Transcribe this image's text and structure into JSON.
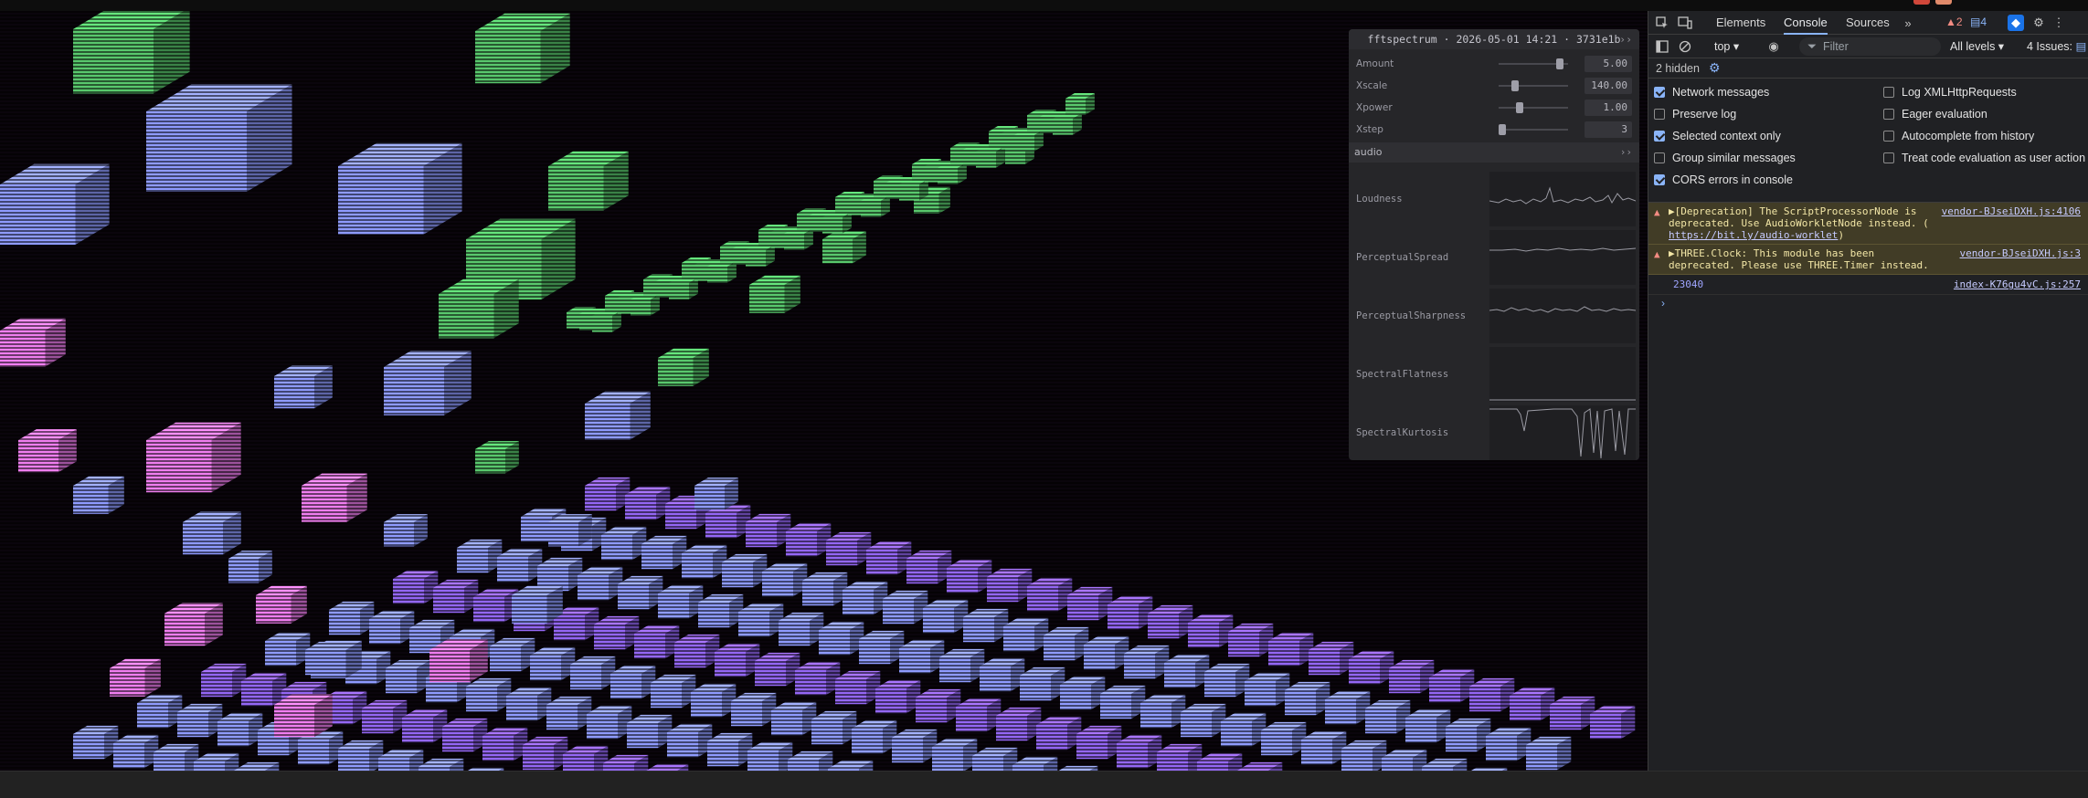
{
  "panel": {
    "title": "fftspectrum · 2026-05-01 14:21 · 3731e1b",
    "collapse_glyph": "››",
    "params": [
      {
        "label": "Amount",
        "value": "5.00",
        "fraction": 0.92
      },
      {
        "label": "Xscale",
        "value": "140.00",
        "fraction": 0.2
      },
      {
        "label": "Xpower",
        "value": "1.00",
        "fraction": 0.28
      },
      {
        "label": "Xstep",
        "value": "3",
        "fraction": 0.0
      }
    ],
    "folder": {
      "label": "audio"
    },
    "graphs": [
      {
        "label": "Loudness"
      },
      {
        "label": "PerceptualSpread"
      },
      {
        "label": "PerceptualSharpness"
      },
      {
        "label": "SpectralFlatness"
      },
      {
        "label": "SpectralKurtosis"
      }
    ]
  },
  "devtools": {
    "tabs": [
      "Elements",
      "Console",
      "Sources"
    ],
    "active_tab": "Console",
    "warn_count": "2",
    "msg_count": "4",
    "context": "top",
    "filter_placeholder": "Filter",
    "levels": "All levels",
    "issues": "4 Issues:",
    "hidden": "2 hidden",
    "settings_left": [
      {
        "label": "Network messages",
        "checked": true
      },
      {
        "label": "Preserve log",
        "checked": false
      },
      {
        "label": "Selected context only",
        "checked": true
      },
      {
        "label": "Group similar messages",
        "checked": false
      },
      {
        "label": "CORS errors in console",
        "checked": true
      }
    ],
    "settings_right": [
      {
        "label": "Log XMLHttpRequests",
        "checked": false
      },
      {
        "label": "Eager evaluation",
        "checked": false
      },
      {
        "label": "Autocomplete from history",
        "checked": false
      },
      {
        "label": "Treat code evaluation as user action",
        "checked": false
      }
    ],
    "messages": [
      {
        "line1": "▶[Deprecation] The ScriptProcessorNode is",
        "line2": "deprecated. Use AudioWorkletNode instead. (",
        "link": "https://bit.ly/audio-worklet",
        "tail": ")",
        "source": "vendor-BJseiDXH.js:4106"
      },
      {
        "line1": "▶THREE.Clock: This module has been",
        "line2": "deprecated. Please use THREE.Timer instead.",
        "source": "vendor-BJseiDXH.js:3"
      }
    ],
    "log": {
      "value": "23040",
      "source": "index-K76gu4vC.js:257"
    },
    "prompt_glyph": "›"
  },
  "colors": {
    "accent": "#8ab4f8",
    "green_block": "#59c86d",
    "purple_block": "#9467f5",
    "pink_block": "#f07ef0",
    "blue_block": "#8f9bff"
  }
}
